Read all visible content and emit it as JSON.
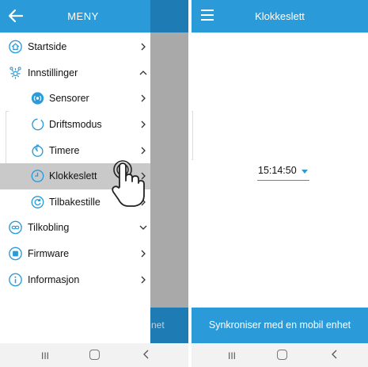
{
  "left": {
    "header": {
      "title": "MENY",
      "back_icon": "arrow-left-icon"
    },
    "menu": [
      {
        "label": "Startside",
        "icon": "home-icon",
        "chevron": "right",
        "level": "top"
      },
      {
        "label": "Innstillinger",
        "icon": "settings-gears-icon",
        "chevron": "up",
        "level": "top"
      },
      {
        "label": "Sensorer",
        "icon": "sensor-icon",
        "chevron": "right",
        "level": "sub"
      },
      {
        "label": "Driftsmodus",
        "icon": "mode-circle-icon",
        "chevron": "right",
        "level": "sub"
      },
      {
        "label": "Timere",
        "icon": "timer-icon",
        "chevron": "right",
        "level": "sub"
      },
      {
        "label": "Klokkeslett",
        "icon": "clock-icon",
        "chevron": "right",
        "level": "sub",
        "selected": true
      },
      {
        "label": "Tilbakestille",
        "icon": "reset-icon",
        "chevron": "right",
        "level": "sub"
      },
      {
        "label": "Tilkobling",
        "icon": "connection-icon",
        "chevron": "down",
        "level": "top"
      },
      {
        "label": "Firmware",
        "icon": "firmware-icon",
        "chevron": "right",
        "level": "top"
      },
      {
        "label": "Informasjon",
        "icon": "info-icon",
        "chevron": "right",
        "level": "top"
      }
    ],
    "dimmed_button_fragment": "net",
    "cursor_icon": "pointing-hand-icon"
  },
  "right": {
    "header": {
      "title": "Klokkeslett",
      "menu_icon": "hamburger-menu-icon"
    },
    "time_value": "15:14:50",
    "sync_button_label": "Synkroniser med en mobil enhet"
  },
  "navbar": {
    "recents_glyph": "III",
    "home_icon": "home-square-icon",
    "back_icon": "back-chevron-icon"
  },
  "colors": {
    "accent": "#2b9ad9",
    "accent_dark": "#1e7bb3",
    "selected_row": "#c9c9c9",
    "dim_overlay": "#a9a9a9"
  }
}
